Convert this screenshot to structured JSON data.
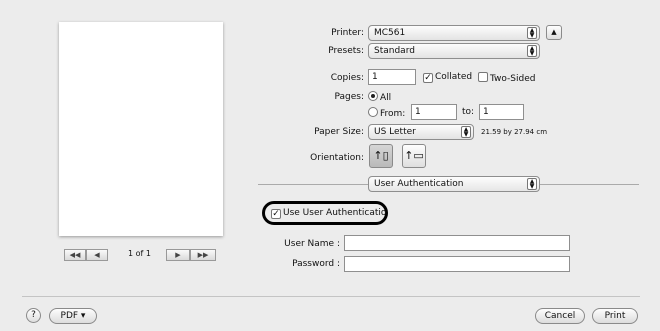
{
  "printer": {
    "label": "Printer:",
    "value": "MC561"
  },
  "presets": {
    "label": "Presets:",
    "value": "Standard"
  },
  "copies": {
    "label": "Copies:",
    "value": "1",
    "collated_label": "Collated",
    "collated_checked": true,
    "two_sided_label": "Two-Sided",
    "two_sided_checked": false
  },
  "pages": {
    "label": "Pages:",
    "all_label": "All",
    "from_label": "From:",
    "from_value": "1",
    "to_label": "to:",
    "to_value": "1"
  },
  "paper_size": {
    "label": "Paper Size:",
    "value": "US Letter",
    "dimensions": "21.59 by 27.94 cm"
  },
  "orientation": {
    "label": "Orientation:"
  },
  "section_popup": {
    "value": "User Authentication"
  },
  "auth": {
    "use_auth_label": "Use User Authenticatio",
    "use_auth_checked": true,
    "username_label": "User Name :",
    "username_value": "",
    "password_label": "Password :",
    "password_value": ""
  },
  "preview": {
    "page_counter": "1 of 1"
  },
  "footer": {
    "help": "?",
    "pdf_label": "PDF ▾",
    "cancel_label": "Cancel",
    "print_label": "Print"
  },
  "icons": {
    "expand": "triangle-up-icon",
    "first": "double-left-icon",
    "prev": "left-icon",
    "next": "right-icon",
    "last": "double-right-icon"
  }
}
